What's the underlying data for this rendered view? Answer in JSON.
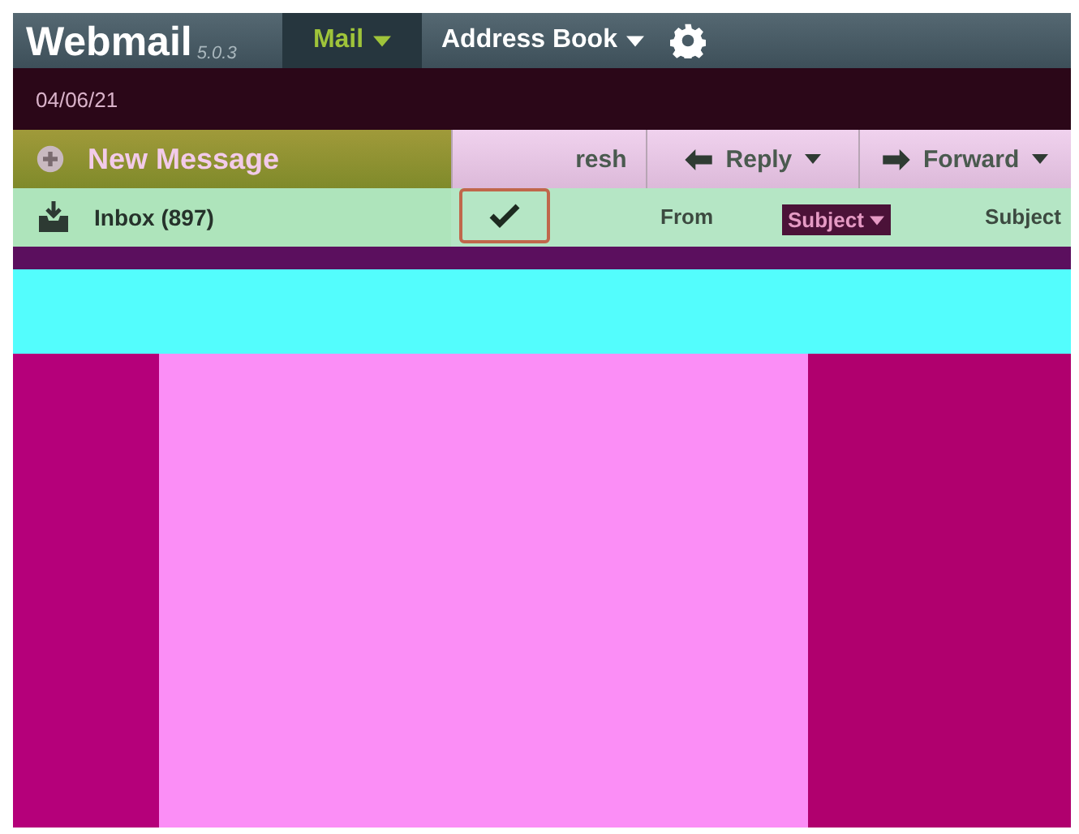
{
  "app": {
    "name": "Webmail",
    "version": "5.0.3"
  },
  "nav": [
    {
      "label": "Mail",
      "selected": true
    },
    {
      "label": "Address Book",
      "selected": false
    }
  ],
  "date": "04/06/21",
  "new_message": "New Message",
  "folders": [
    {
      "label": "Inbox (897)",
      "selected": true
    }
  ],
  "toolbar": [
    {
      "label": "resh",
      "kind": "plain"
    },
    {
      "label": "Reply",
      "kind": "back"
    },
    {
      "label": "Forward",
      "kind": "ahead"
    }
  ],
  "select_all_checked": true,
  "columns": [
    {
      "label": "From",
      "kind": "plain"
    },
    {
      "label": "Subject",
      "kind": "dropdown"
    },
    {
      "label": "Subject",
      "kind": "plain"
    }
  ]
}
